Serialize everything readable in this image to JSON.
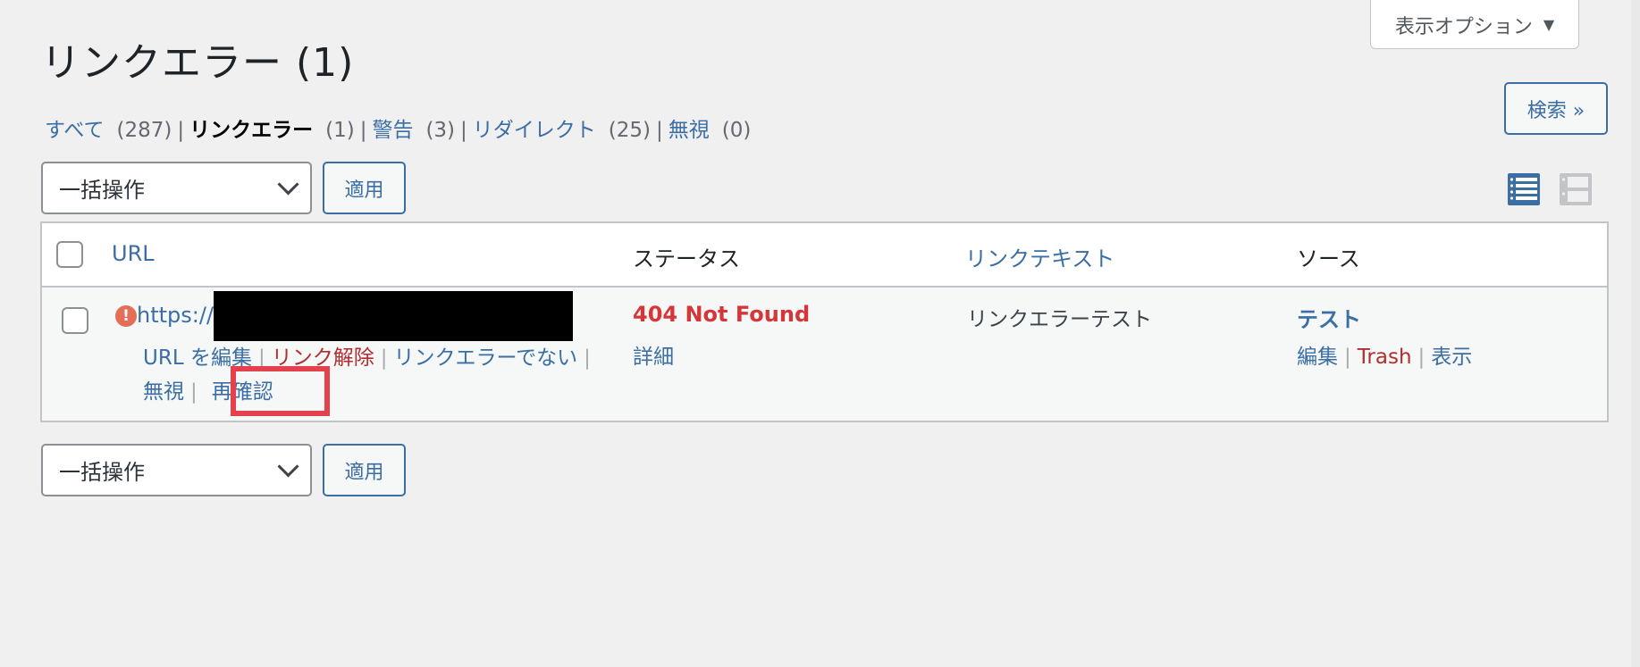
{
  "screen_options": {
    "label": "表示オプション",
    "arrow": "▼"
  },
  "page_title": "リンクエラー (1)",
  "filters": [
    {
      "label": "すべて",
      "count": "(287)",
      "current": false
    },
    {
      "label": "リンクエラー",
      "count": "(1)",
      "current": true
    },
    {
      "label": "警告",
      "count": "(3)",
      "current": false
    },
    {
      "label": "リダイレクト",
      "count": "(25)",
      "current": false
    },
    {
      "label": "無視",
      "count": "(0)",
      "current": false
    }
  ],
  "filter_separator": "|",
  "search_button": "検索 »",
  "bulk_top": {
    "select_value": "一括操作",
    "apply_label": "適用"
  },
  "bulk_bottom": {
    "select_value": "一括操作",
    "apply_label": "適用"
  },
  "view_modes": [
    {
      "name": "compact-view",
      "active": true,
      "color": "#3a6ea5"
    },
    {
      "name": "detail-view",
      "active": false,
      "color": "#c3c4c7"
    }
  ],
  "table": {
    "columns": [
      "URL",
      "ステータス",
      "リンクテキスト",
      "ソース"
    ],
    "rows": [
      {
        "url_prefix": "https://",
        "url_redacted": true,
        "url_actions": [
          "URL を編集",
          "リンク解除",
          "リンクエラーでない",
          "無視",
          "再確認"
        ],
        "url_actions_wrapped_tail": "い",
        "status": "404 Not Found",
        "status_action": "詳細",
        "link_text": "リンクエラーテスト",
        "source": "テスト",
        "source_actions": [
          "編集",
          "Trash",
          "表示"
        ]
      }
    ]
  },
  "colors": {
    "link": "#3a6ea5",
    "error": "#d63638",
    "danger": "#b32d2e",
    "highlight": "#e5414d"
  }
}
